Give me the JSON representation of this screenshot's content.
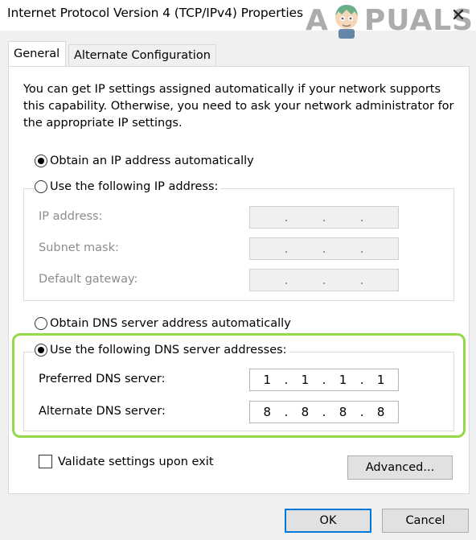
{
  "window": {
    "title": "Internet Protocol Version 4 (TCP/IPv4) Properties",
    "close_glyph": "✕",
    "watermark": {
      "lead": "A",
      "rest": "PUALS"
    }
  },
  "tabs": [
    {
      "label": "General",
      "active": true
    },
    {
      "label": "Alternate Configuration",
      "active": false
    }
  ],
  "intro_text": "You can get IP settings assigned automatically if your network supports this capability. Otherwise, you need to ask your network administrator for the appropriate IP settings.",
  "ip_section": {
    "auto_label": "Obtain an IP address automatically",
    "auto_selected": true,
    "manual_label": "Use the following IP address:",
    "manual_selected": false,
    "fields": [
      {
        "label": "IP address:",
        "value": [
          ".",
          ".",
          "."
        ]
      },
      {
        "label": "Subnet mask:",
        "value": [
          ".",
          ".",
          "."
        ]
      },
      {
        "label": "Default gateway:",
        "value": [
          ".",
          ".",
          "."
        ]
      }
    ]
  },
  "dns_section": {
    "auto_label": "Obtain DNS server address automatically",
    "auto_selected": false,
    "manual_label": "Use the following DNS server addresses:",
    "manual_selected": true,
    "preferred": {
      "label": "Preferred DNS server:",
      "octets": [
        "1",
        "1",
        "1",
        "1"
      ]
    },
    "alternate": {
      "label": "Alternate DNS server:",
      "octets": [
        "8",
        "8",
        "8",
        "8"
      ]
    }
  },
  "validate_label": "Validate settings upon exit",
  "validate_checked": false,
  "buttons": {
    "advanced": "Advanced...",
    "ok": "OK",
    "cancel": "Cancel"
  },
  "colors": {
    "highlight": "#93d94a",
    "ok_border": "#0078d7"
  }
}
